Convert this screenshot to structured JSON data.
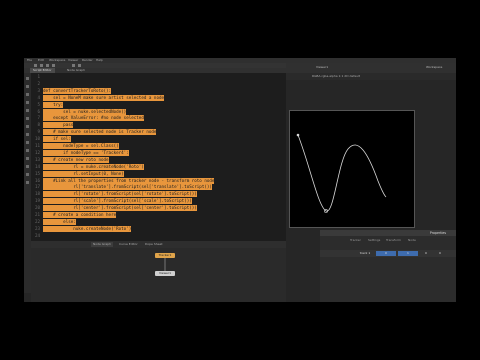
{
  "menubar": {
    "items": [
      "File",
      "Edit",
      "Workspace",
      "Viewer",
      "Render",
      "Help"
    ]
  },
  "tabs": [
    {
      "label": "Script Editor",
      "active": true
    },
    {
      "label": "Node Graph",
      "active": false
    }
  ],
  "viewer": {
    "title": "Viewer1",
    "workspace": "Workspace",
    "info": "RGBA  rgba.alpha  1:1  2D  default",
    "frame": "1"
  },
  "code_lines": [
    {
      "n": "1",
      "text": "",
      "hl": false
    },
    {
      "n": "2",
      "text": "",
      "hl": false
    },
    {
      "n": "3",
      "text": "def convertTrackerToRoto():",
      "hl": true
    },
    {
      "n": "4",
      "text": "    sel = NoneM make sure artist selected a node",
      "hl": true
    },
    {
      "n": "5",
      "text": "    try:",
      "hl": true
    },
    {
      "n": "6",
      "text": "        sel = nuke.selectedNode()",
      "hl": true
    },
    {
      "n": "7",
      "text": "    except ValueError: #no node selected",
      "hl": true
    },
    {
      "n": "8",
      "text": "        pass",
      "hl": true
    },
    {
      "n": "9",
      "text": "    # make sure selected node is Tracker node",
      "hl": true
    },
    {
      "n": "10",
      "text": "    if sel:",
      "hl": true
    },
    {
      "n": "11",
      "text": "        nodeType = sel.Class()",
      "hl": true
    },
    {
      "n": "12",
      "text": "        if nodeType == 'Tracker4':",
      "hl": true
    },
    {
      "n": "13",
      "text": "    # create new roto node",
      "hl": true
    },
    {
      "n": "14",
      "text": "            rl = nuke.createNode('Roto')",
      "hl": true
    },
    {
      "n": "15",
      "text": "            rl.setInput(0, None)",
      "hl": true
    },
    {
      "n": "16",
      "text": "    #Link all the properties from tracker node - transform roto node",
      "hl": true
    },
    {
      "n": "17",
      "text": "            rl['translate'].fromScript(sel['translate'].toScript())",
      "hl": true
    },
    {
      "n": "18",
      "text": "            rl['rotate'].fromScript(sel['rotate'].toScript())",
      "hl": true
    },
    {
      "n": "19",
      "text": "            rl['scale'].fromScript(sel['scale'].toScript())",
      "hl": true
    },
    {
      "n": "20",
      "text": "            rl['center'].fromScript(sel['center'].toScript())",
      "hl": true
    },
    {
      "n": "21",
      "text": "    # create a condition here",
      "hl": true
    },
    {
      "n": "22",
      "text": "        else:",
      "hl": true
    },
    {
      "n": "23",
      "text": "            nuke.createNode('Roto')",
      "hl": true
    },
    {
      "n": "24",
      "text": "",
      "hl": false
    }
  ],
  "graph": {
    "tabs": [
      "Node Graph",
      "Curve Editor",
      "Dope Sheet"
    ],
    "nodes": [
      {
        "label": "Tracker1",
        "color": "#e0a44a"
      },
      {
        "label": "Viewer1",
        "color": "#cfcfcf"
      }
    ]
  },
  "properties": {
    "title": "Properties",
    "tabs": [
      "Tracker",
      "Settings",
      "Transform",
      "Node"
    ],
    "row": [
      "track 1",
      "0",
      "1",
      "0",
      "0"
    ]
  },
  "colors": {
    "highlight": "#e8963c",
    "panel": "#262626",
    "editor": "#1d1d1d",
    "accent": "#3e6cae"
  }
}
